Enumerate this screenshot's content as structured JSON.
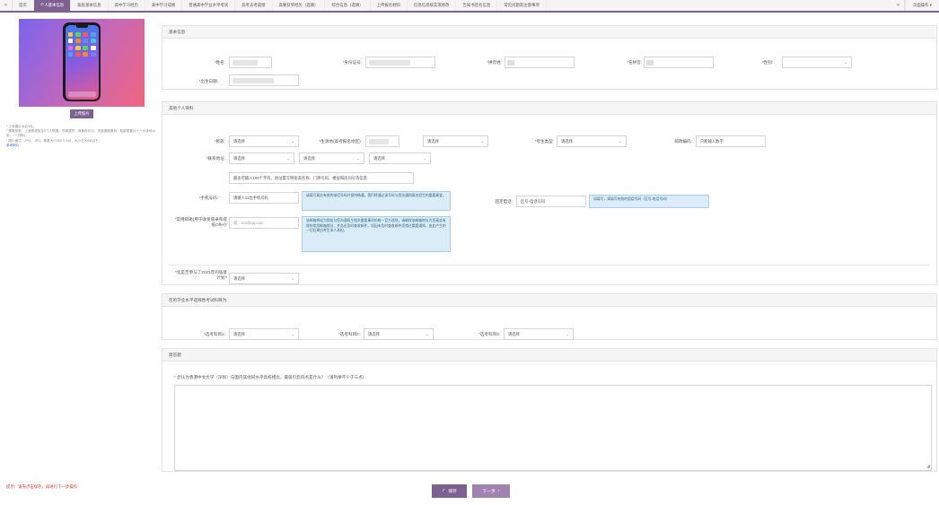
{
  "tabbar": {
    "prev": "«",
    "next": "»",
    "tabs": [
      "首页",
      "个人基本信息",
      "家庭基本信息",
      "高中学习经历",
      "高中学习成绩",
      "普通高中学业水平考试",
      "高考志考成绩",
      "高要获奖经历（选填）",
      "综合信息（选填）",
      "上传报名材料",
      "信息信息核实或修改",
      "告知书签名信息",
      "常见问题及注意事项"
    ],
    "active_index": 1,
    "page_ops": "页面操作"
  },
  "photo": {
    "upload_label": "上传照片",
    "notes": [
      "* 上传图片为近3月。",
      "* 需要形制，上身照请放至5寸人物器，衣服整齐，背景色均匀，须能清晰看到，脸部更靠近十八分钟地以前，一寸照片。",
      "* 图片格式：JPG、JPG、像素大小300 X 440，大小在50KB以下。"
    ],
    "reference_link": "参考照片"
  },
  "basic": {
    "title": "基本信息",
    "name_label": "姓名:",
    "id_label": "身份证号:",
    "pinyin_surname_label": "拼音姓:",
    "pinyin_given_label": "名拼音:",
    "gender_label": "性别:",
    "birth_label": "出生日期:"
  },
  "other": {
    "title": "其他个人资料",
    "ethnicity_label": "民族:",
    "ethnicity_value": "请选择",
    "exam_place_label": "生源地(高考报名地区):",
    "exam_place_value": "请选择",
    "candidate_type_label": "考生类型:",
    "candidate_type_value": "请选择",
    "postcode_label": "邮政编码:",
    "postcode_placeholder": "只能输入数字",
    "address_label": "联系地址:",
    "address_selects": [
      "请选择",
      "请选择",
      "请选择"
    ],
    "address_placeholder": "最多可输入100个字符。地址需写明街道名称、门牌号码、楼层和房间号等信息",
    "phone_label": "手机号码:",
    "phone_placeholder": "请输入11位手机号码",
    "phone_info": "请填写真实有效的电话号码并保持畅通，我们将通过该号码与您沟通和报名招生的重要事宜。",
    "landline_label": "固定电话:",
    "landline_placeholder": "区号-电话号码",
    "landline_info": "如填写，请填写有效的固话号码（区号-电话号码）",
    "email_label": "常用邮箱(用于收发值录和提纸Offer):",
    "email_placeholder": "如：xxx@qq.com",
    "email_info": "该邮箱将成为我校与您沟通招生相关重要事项的唯一官方途径，请确保该邮箱地址为您真实有效的常用邮箱地址，并务必及时查收邮件。如因未及时查收邮件而错过重要通知，由此产生的一切后果由考生本人承担。",
    "plan_label": "您是否参与了2021年的强基计划?",
    "plan_value": "请选择"
  },
  "subjects": {
    "title": "您的学业水平选择性考试科目为:",
    "s1_label": "选考科目1:",
    "s2_label": "选考科目2:",
    "s3_label": "选考科目3:",
    "value": "请选择"
  },
  "brief": {
    "title": "简答题",
    "question": "您认为香港中文大学（深圳）与国内其他同水平高校相比，最吸引您的点是什么？（请列举不少于三点）"
  },
  "footer": {
    "tip": "提示：请先点击保存，再进行下一步操作",
    "save_label": "保存",
    "next_label": "下一步"
  }
}
